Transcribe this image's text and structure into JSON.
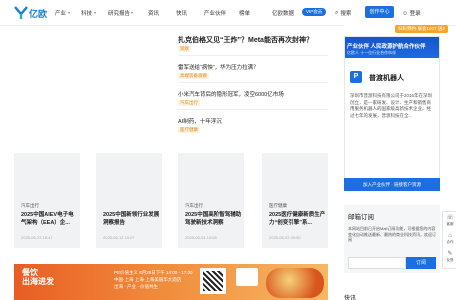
{
  "header": {
    "logo_text": "亿欧",
    "nav": [
      "产业",
      "科技",
      "研究报告",
      "资讯",
      "快讯",
      "产业伙伴",
      "榜单",
      "亿欧数据"
    ],
    "vip_label": "VIP会员",
    "search_label": "搜索",
    "create_center": "创作中心",
    "login": "登录"
  },
  "headline": "扎克伯格又见“王炸”？Meta能否再次封神？",
  "headline_tag": "观察",
  "list": [
    {
      "title": "雷军送给“病怏”，华为压力拉满？",
      "tag": "高端装备观察"
    },
    {
      "title": "小米汽车背后的隐形冠军，凌空6000亿市场",
      "tag": "汽车出行"
    },
    {
      "title": "AI制药，十年浮沉",
      "tag": "医疗健康"
    }
  ],
  "cards": [
    {
      "category": "汽车出行",
      "title": "2025中国AIEV电子电气架构（EEA）企...",
      "date": "2025-06-23 18:47"
    },
    {
      "category": "",
      "title": "2025中国新领行业发展洞察报告",
      "date": "2025-06-12 15:07"
    },
    {
      "category": "汽车出行",
      "title": "2025中国高阶智驾辅助驾驶新技术洞察",
      "date": "2025-06-04 14:08"
    },
    {
      "category": "医疗健康",
      "title": "2025医疗健康新质生产力“创变引擎”系...",
      "date": "2025-06-03 09:50"
    }
  ],
  "banner": {
    "title_line1": "餐饮",
    "title_line2": "出海进发",
    "text_line1": "PE价值主义 8月28日下午 14:00 - 17:00",
    "text_line2": "中国·上海 上海·上海美丽华大酒店",
    "text_line3": "出海 · 产业 · 价值共生"
  },
  "sidebar": {
    "badge": "扫码预约·展会100T 送2",
    "ad_head": "产业伙伴 人民政源护航合作伙伴",
    "ad_sub": "亿欧人 十一位行业合作伙伴",
    "company_name": "普渡机器人",
    "company_desc": "深圳市普渡科技有限公司于2016年在深圳创立，是一家研发、设计、生产和销售商用服务机器人的国家级高新技术企业。经过七年的发展，普渡科技在全...",
    "ad_footer": "加入产业伙伴 · 链接客户资源",
    "subscribe_title": "邮箱订阅",
    "subscribe_desc": "本网站目前已开启Mail订阅功能，可根据您的内容变化自动推送最新、最热的商业科技资讯，欢迎订阅",
    "subscribe_placeholder": "",
    "subscribe_btn": "订阅",
    "footer_label": "快讯"
  },
  "float": [
    {
      "icon": "☏",
      "label": "客服"
    },
    {
      "icon": "⌂",
      "label": "合作"
    },
    {
      "icon": "✎",
      "label": "反馈"
    }
  ],
  "colors": {
    "brand": "#1b6fe0",
    "tag": "#e08a1e",
    "banner": "#e85d24"
  }
}
